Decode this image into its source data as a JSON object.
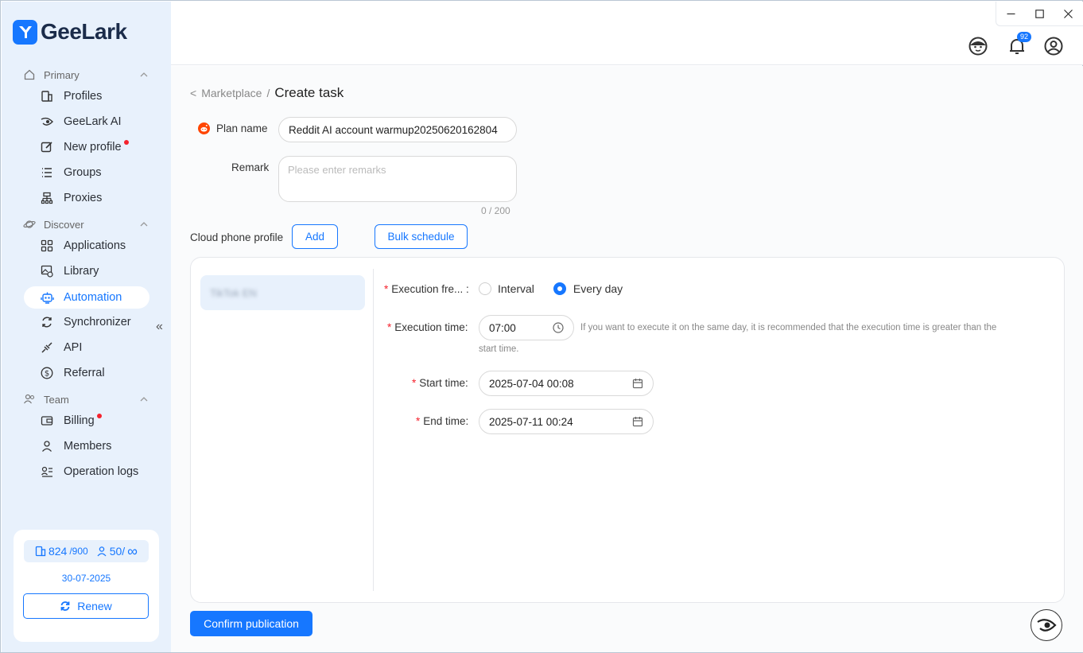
{
  "app": {
    "name": "GeeLark"
  },
  "sidebar": {
    "sections": [
      {
        "label": "Primary"
      },
      {
        "label": "Discover"
      },
      {
        "label": "Team"
      }
    ],
    "items": [
      {
        "label": "Profiles"
      },
      {
        "label": "GeeLark AI"
      },
      {
        "label": "New profile"
      },
      {
        "label": "Groups"
      },
      {
        "label": "Proxies"
      },
      {
        "label": "Applications"
      },
      {
        "label": "Library"
      },
      {
        "label": "Automation"
      },
      {
        "label": "Synchronizer"
      },
      {
        "label": "API"
      },
      {
        "label": "Referral"
      },
      {
        "label": "Billing"
      },
      {
        "label": "Members"
      },
      {
        "label": "Operation logs"
      }
    ],
    "collapse_symbol": "«",
    "quota": {
      "profiles_used": "824",
      "profiles_total": "/900",
      "members_used": "50/",
      "members_total": "∞",
      "date": "30-07-2025",
      "renew_label": "Renew"
    }
  },
  "header": {
    "notification_count": "92"
  },
  "breadcrumb": {
    "back": "<",
    "parent": "Marketplace",
    "separator": "/",
    "current": "Create task"
  },
  "form": {
    "plan_name_label": "Plan name",
    "plan_name_value": "Reddit AI account warmup20250620162804",
    "remark_label": "Remark",
    "remark_placeholder": "Please enter remarks",
    "remark_counter": "0 / 200",
    "cloud_profile_label": "Cloud phone profile",
    "add_label": "Add",
    "bulk_schedule_label": "Bulk schedule"
  },
  "panel": {
    "profile_name": "TikTok EN",
    "frequency_label": "Execution fre... :",
    "frequency_options": [
      "Interval",
      "Every day"
    ],
    "frequency_selected": "Every day",
    "execution_time_label": "Execution time:",
    "execution_time_value": "07:00",
    "execution_hint_line1": "If you want to execute it on the same day, it is recommended that the execution time is greater than the",
    "execution_hint_line2": "start time.",
    "start_time_label": "Start time:",
    "start_time_value": "2025-07-04 00:08",
    "end_time_label": "End time:",
    "end_time_value": "2025-07-11 00:24"
  },
  "confirm_label": "Confirm publication",
  "colors": {
    "accent": "#1677ff",
    "sidebar_bg": "#e8f1fc",
    "required": "#f5222d",
    "reddit": "#ff4500"
  }
}
